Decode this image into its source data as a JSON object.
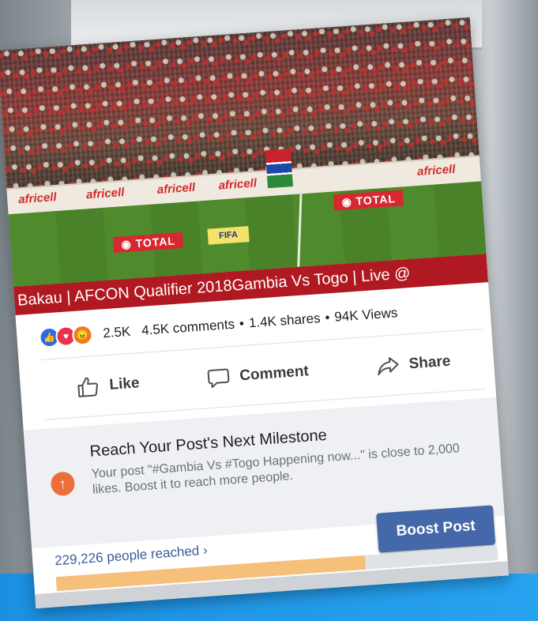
{
  "video": {
    "ticker_text": "Bakau | AFCON Qualifier 2018Gambia Vs Togo | Live @",
    "sponsor_main": "africell",
    "sponsor_total": "TOTAL",
    "sponsor_fifa": "FIFA"
  },
  "stats": {
    "reaction_count": "2.5K",
    "comments": "4.5K comments",
    "shares": "1.4K shares",
    "views": "94K Views",
    "separator": "•"
  },
  "actions": {
    "like_label": "Like",
    "comment_label": "Comment",
    "share_label": "Share"
  },
  "milestone": {
    "title": "Reach Your Post's Next Milestone",
    "body": "Your post \"#Gambia Vs #Togo Happening now...\" is close to 2,000 likes. Boost it to reach more people."
  },
  "footer": {
    "reach_text": "229,226 people reached",
    "reach_chevron": "›",
    "boost_label": "Boost Post",
    "progress_fraction": 0.7
  },
  "colors": {
    "boost_blue": "#4468a9",
    "ticker_red": "#b01921",
    "milestone_orange": "#ec6f3b",
    "progress_fill": "#f5c07a"
  }
}
